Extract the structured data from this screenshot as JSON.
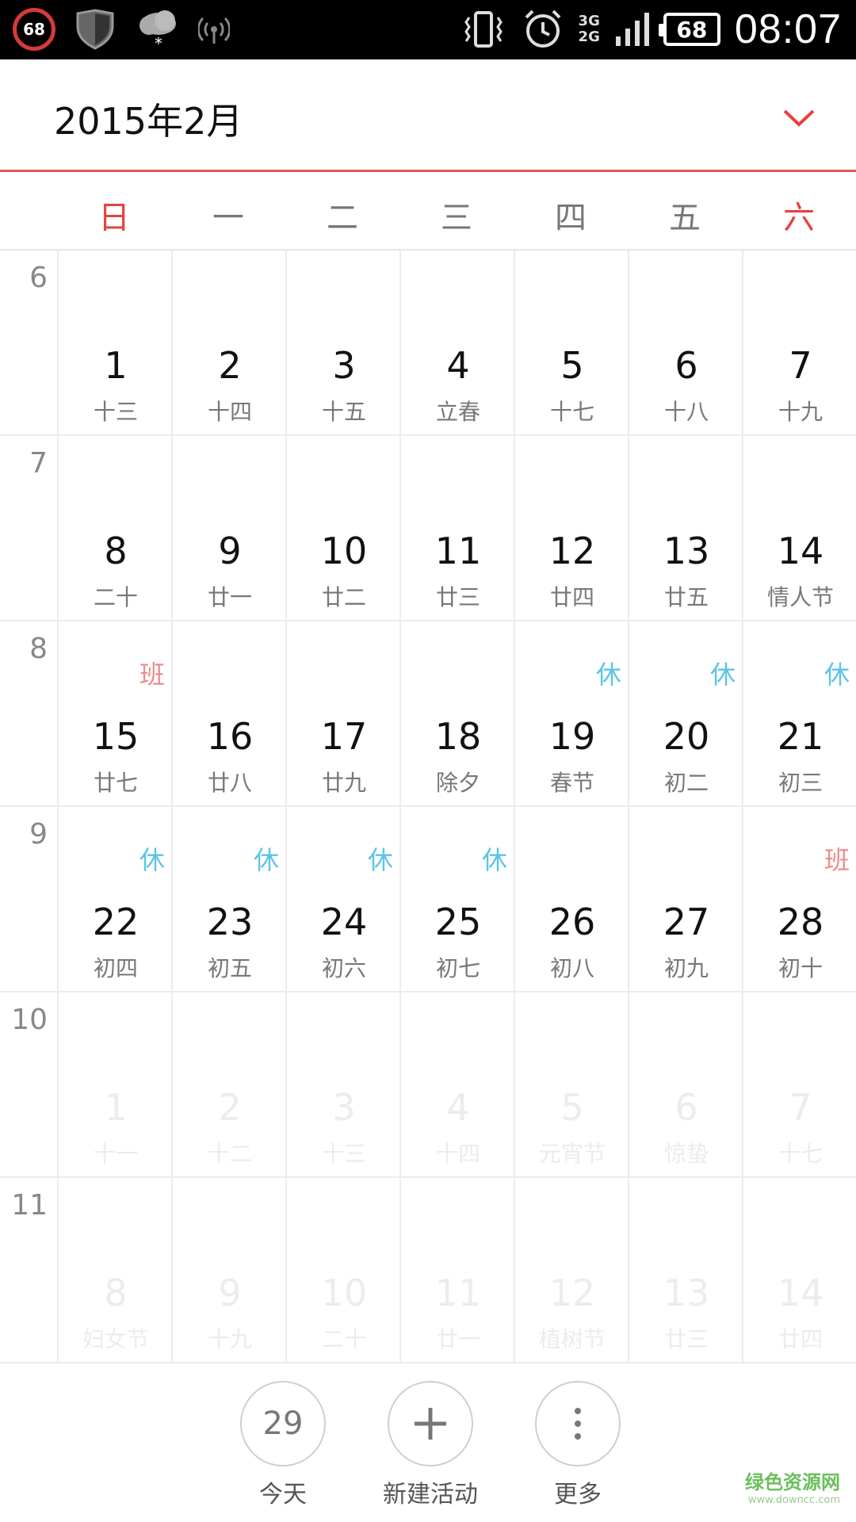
{
  "status_bar": {
    "left_badge": "68",
    "network": [
      "3G",
      "2G"
    ],
    "battery": "68",
    "time": "08:07",
    "icons": [
      "shield-icon",
      "weather-snow-icon",
      "hotspot-icon",
      "vibrate-icon",
      "alarm-icon",
      "signal-icon",
      "battery-icon"
    ]
  },
  "header": {
    "month": "2015年2月",
    "accent_color": "#e8413d"
  },
  "weekdays": [
    "日",
    "一",
    "二",
    "三",
    "四",
    "五",
    "六"
  ],
  "weeks": [
    {
      "week": "6",
      "days": [
        {
          "n": "1",
          "l": "十三",
          "t": ""
        },
        {
          "n": "2",
          "l": "十四",
          "t": ""
        },
        {
          "n": "3",
          "l": "十五",
          "t": ""
        },
        {
          "n": "4",
          "l": "立春",
          "t": ""
        },
        {
          "n": "5",
          "l": "十七",
          "t": ""
        },
        {
          "n": "6",
          "l": "十八",
          "t": ""
        },
        {
          "n": "7",
          "l": "十九",
          "t": ""
        }
      ]
    },
    {
      "week": "7",
      "days": [
        {
          "n": "8",
          "l": "二十",
          "t": ""
        },
        {
          "n": "9",
          "l": "廿一",
          "t": ""
        },
        {
          "n": "10",
          "l": "廿二",
          "t": ""
        },
        {
          "n": "11",
          "l": "廿三",
          "t": ""
        },
        {
          "n": "12",
          "l": "廿四",
          "t": ""
        },
        {
          "n": "13",
          "l": "廿五",
          "t": ""
        },
        {
          "n": "14",
          "l": "情人节",
          "t": ""
        }
      ]
    },
    {
      "week": "8",
      "days": [
        {
          "n": "15",
          "l": "廿七",
          "t": "班"
        },
        {
          "n": "16",
          "l": "廿八",
          "t": ""
        },
        {
          "n": "17",
          "l": "廿九",
          "t": ""
        },
        {
          "n": "18",
          "l": "除夕",
          "t": ""
        },
        {
          "n": "19",
          "l": "春节",
          "t": "休"
        },
        {
          "n": "20",
          "l": "初二",
          "t": "休"
        },
        {
          "n": "21",
          "l": "初三",
          "t": "休"
        }
      ]
    },
    {
      "week": "9",
      "days": [
        {
          "n": "22",
          "l": "初四",
          "t": "休"
        },
        {
          "n": "23",
          "l": "初五",
          "t": "休"
        },
        {
          "n": "24",
          "l": "初六",
          "t": "休"
        },
        {
          "n": "25",
          "l": "初七",
          "t": "休"
        },
        {
          "n": "26",
          "l": "初八",
          "t": ""
        },
        {
          "n": "27",
          "l": "初九",
          "t": ""
        },
        {
          "n": "28",
          "l": "初十",
          "t": "班"
        }
      ]
    },
    {
      "week": "10",
      "other": true,
      "days": [
        {
          "n": "1",
          "l": "十一",
          "t": ""
        },
        {
          "n": "2",
          "l": "十二",
          "t": ""
        },
        {
          "n": "3",
          "l": "十三",
          "t": ""
        },
        {
          "n": "4",
          "l": "十四",
          "t": ""
        },
        {
          "n": "5",
          "l": "元宵节",
          "t": ""
        },
        {
          "n": "6",
          "l": "惊蛰",
          "t": ""
        },
        {
          "n": "7",
          "l": "十七",
          "t": ""
        }
      ]
    },
    {
      "week": "11",
      "other": true,
      "days": [
        {
          "n": "8",
          "l": "妇女节",
          "t": ""
        },
        {
          "n": "9",
          "l": "十九",
          "t": ""
        },
        {
          "n": "10",
          "l": "二十",
          "t": ""
        },
        {
          "n": "11",
          "l": "廿一",
          "t": ""
        },
        {
          "n": "12",
          "l": "植树节",
          "t": ""
        },
        {
          "n": "13",
          "l": "廿三",
          "t": ""
        },
        {
          "n": "14",
          "l": "廿四",
          "t": ""
        }
      ]
    }
  ],
  "tag_colors": {
    "休": "#5cc4e6",
    "班": "#f08a8a"
  },
  "bottom": {
    "today_num": "29",
    "today_label": "今天",
    "new_label": "新建活动",
    "more_label": "更多"
  },
  "watermark": {
    "main": "绿色资源网",
    "sub": "www.downcc.com"
  }
}
